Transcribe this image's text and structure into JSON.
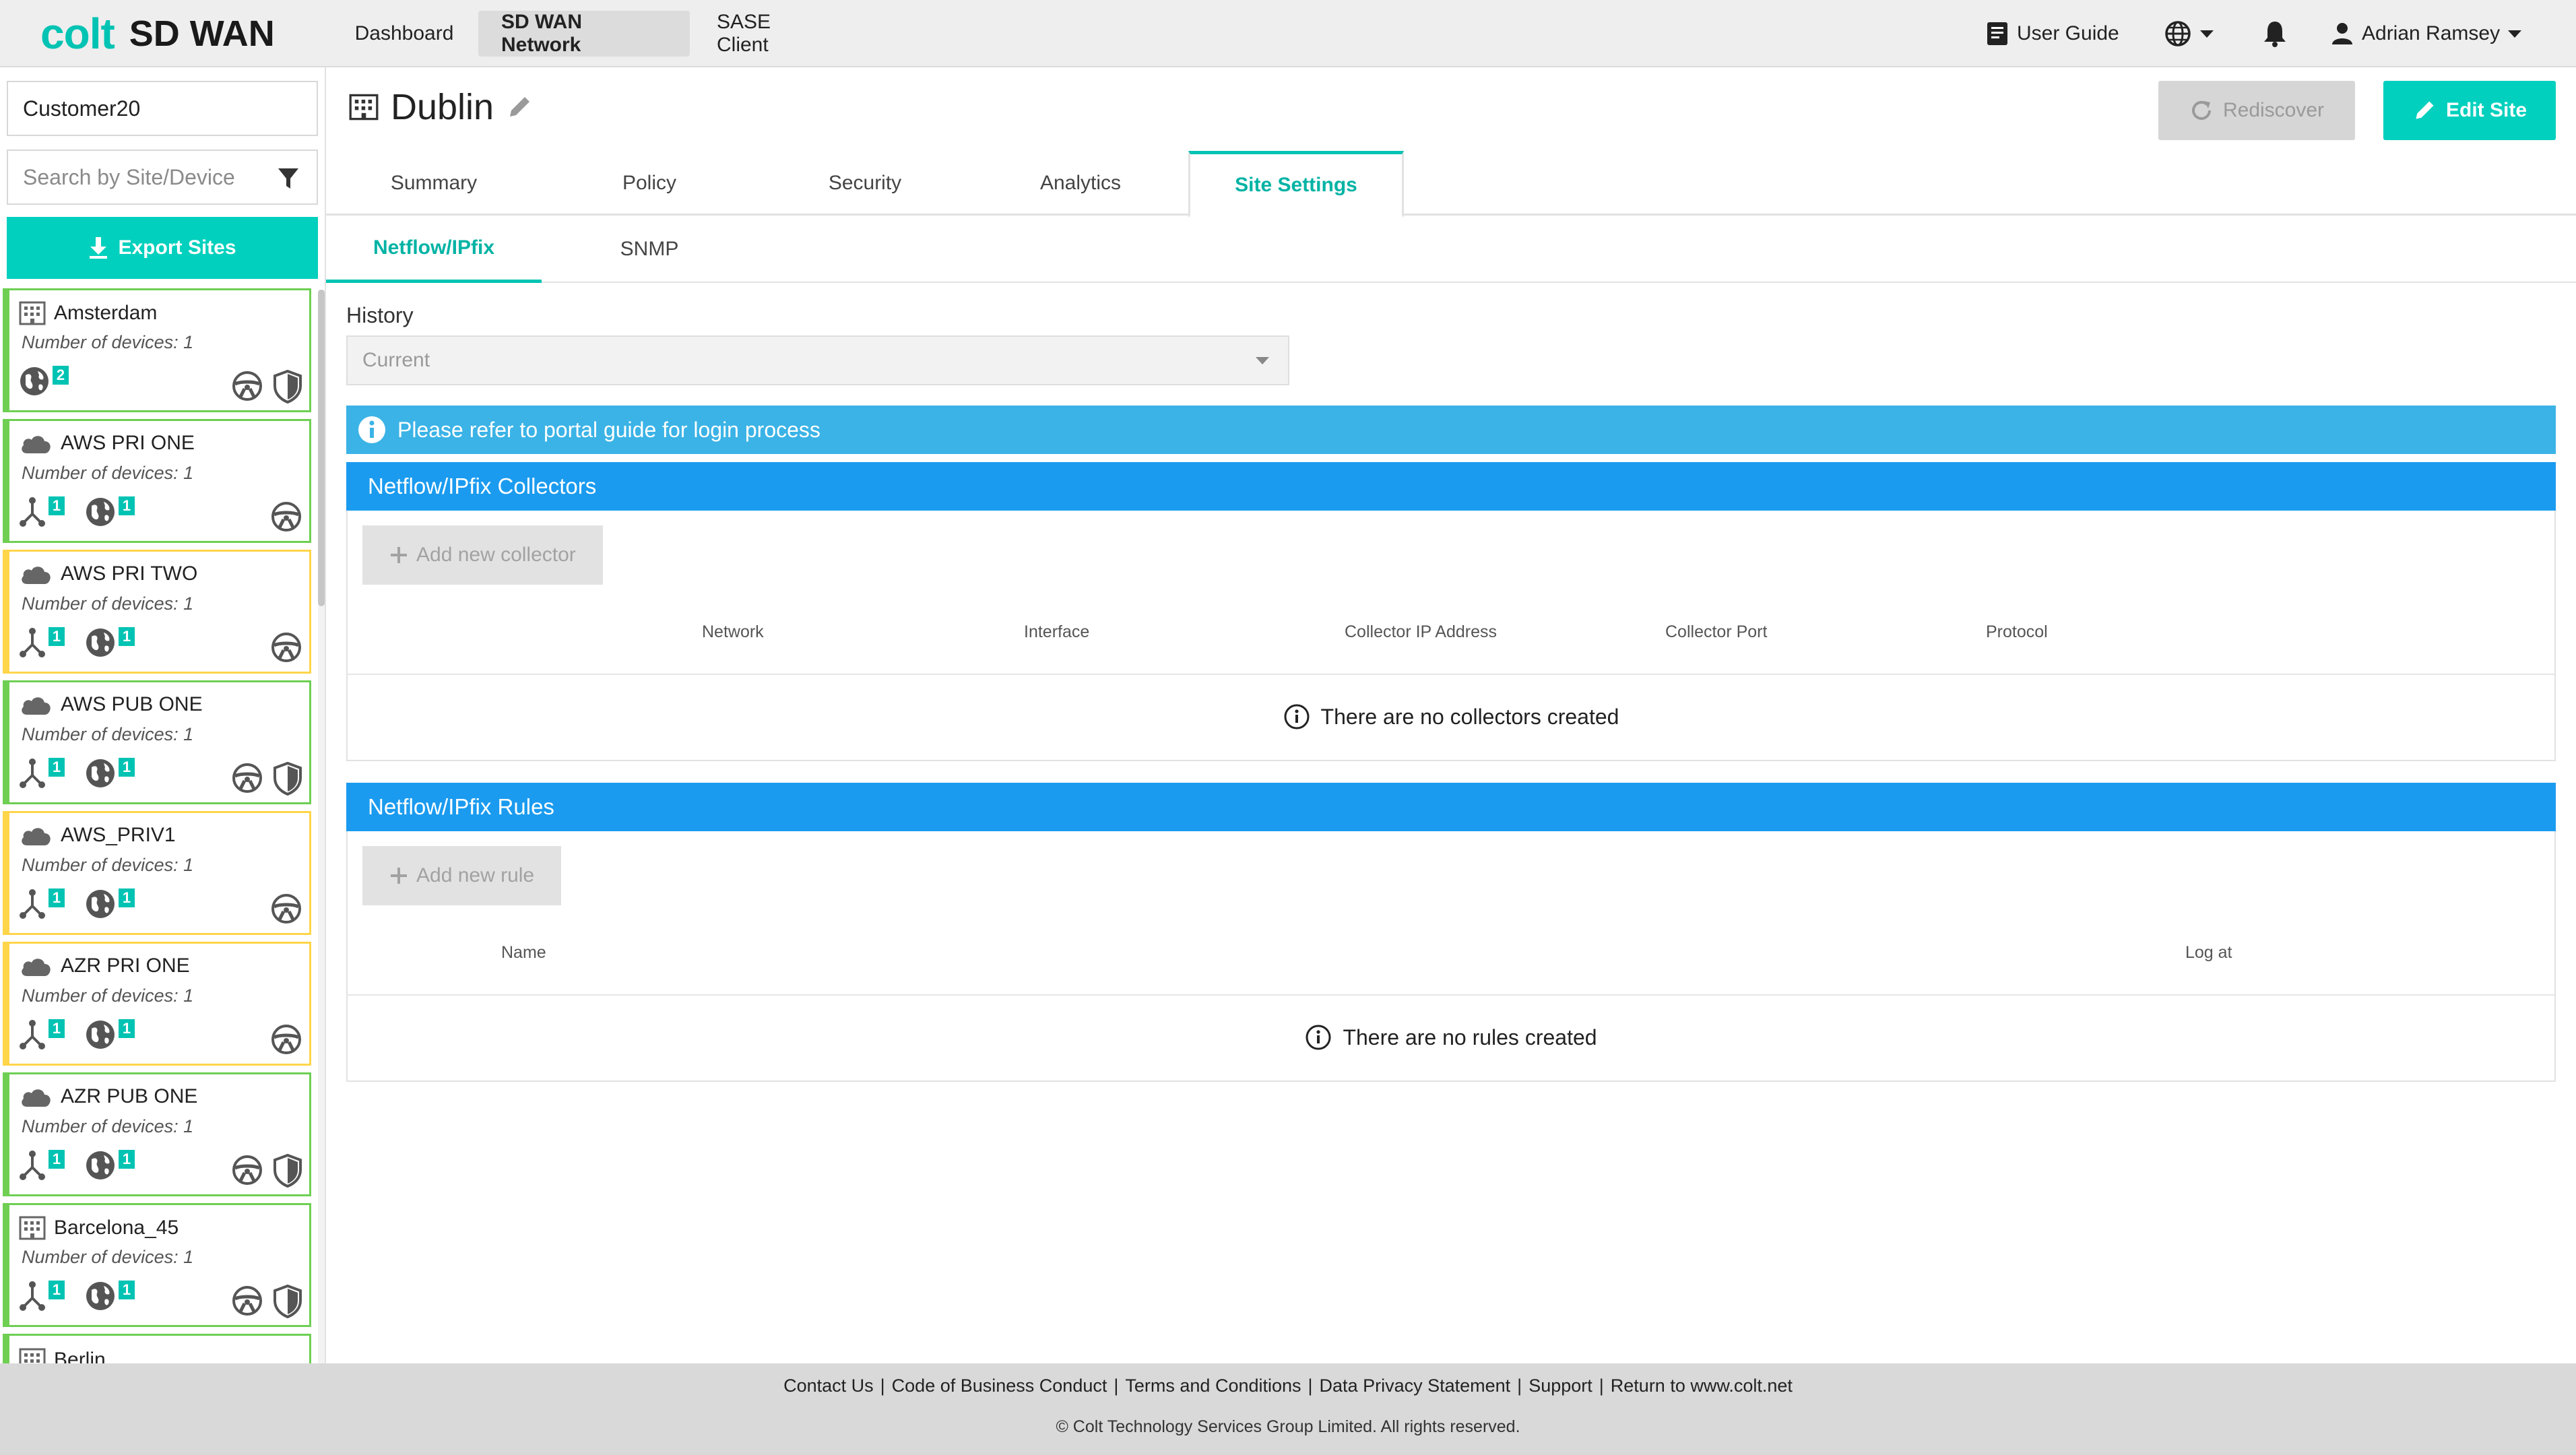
{
  "header": {
    "logo_colt": "colt",
    "logo_product": "SD WAN",
    "nav": [
      "Dashboard",
      "SD WAN Network",
      "SASE Client"
    ],
    "active_nav": "SD WAN Network",
    "user_guide": "User Guide",
    "user_name": "Adrian Ramsey"
  },
  "sidebar": {
    "customer": "Customer20",
    "search_placeholder": "Search by Site/Device",
    "export_label": "Export Sites",
    "sites": [
      {
        "name": "Amsterdam",
        "count": "Number of devices: 1",
        "status": "ok",
        "type": "building",
        "badges": [
          "2"
        ]
      },
      {
        "name": "AWS PRI ONE",
        "count": "Number of devices: 1",
        "status": "ok",
        "type": "cloud",
        "badges": [
          "1",
          "1"
        ]
      },
      {
        "name": "AWS PRI TWO",
        "count": "Number of devices: 1",
        "status": "warn",
        "type": "cloud",
        "badges": [
          "1",
          "1"
        ]
      },
      {
        "name": "AWS PUB ONE",
        "count": "Number of devices: 1",
        "status": "ok",
        "type": "cloud",
        "badges": [
          "1",
          "1"
        ]
      },
      {
        "name": "AWS_PRIV1",
        "count": "Number of devices: 1",
        "status": "warn",
        "type": "cloud",
        "badges": [
          "1",
          "1"
        ]
      },
      {
        "name": "AZR PRI ONE",
        "count": "Number of devices: 1",
        "status": "warn",
        "type": "cloud",
        "badges": [
          "1",
          "1"
        ]
      },
      {
        "name": "AZR PUB ONE",
        "count": "Number of devices: 1",
        "status": "ok",
        "type": "cloud",
        "badges": [
          "1",
          "1"
        ]
      },
      {
        "name": "Barcelona_45",
        "count": "Number of devices: 1",
        "status": "ok",
        "type": "building",
        "badges": [
          "1",
          "1"
        ]
      },
      {
        "name": "Berlin",
        "count": "",
        "status": "ok",
        "type": "building",
        "badges": []
      }
    ]
  },
  "main": {
    "title": "Dublin",
    "rediscover": "Rediscover",
    "edit_site": "Edit Site",
    "tabs": [
      "Summary",
      "Policy",
      "Security",
      "Analytics",
      "Site Settings"
    ],
    "active_tab": "Site Settings",
    "subtabs": [
      "Netflow/IPfix",
      "SNMP"
    ],
    "active_subtab": "Netflow/IPfix",
    "history_label": "History",
    "history_value": "Current",
    "info_banner": "Please refer to portal guide for login process",
    "collectors": {
      "title": "Netflow/IPfix Collectors",
      "add_label": "Add new collector",
      "columns": [
        "Network",
        "Interface",
        "Collector IP Address",
        "Collector Port",
        "Protocol"
      ],
      "empty": "There are no collectors created"
    },
    "rules": {
      "title": "Netflow/IPfix Rules",
      "add_label": "Add new rule",
      "columns": [
        "Name",
        "Log at"
      ],
      "empty": "There are no rules created"
    }
  },
  "footer": {
    "links": [
      "Contact Us",
      "Code of Business Conduct",
      "Terms and Conditions",
      "Data Privacy Statement",
      "Support",
      "Return to www.colt.net"
    ],
    "copyright": "© Colt Technology Services Group Limited. All rights reserved."
  },
  "colors": {
    "accent": "#00c3b3",
    "section_header": "#1a9bef",
    "info_banner": "#3bb3e6",
    "status_ok": "#6ecf53",
    "status_warn": "#ffd54a"
  }
}
